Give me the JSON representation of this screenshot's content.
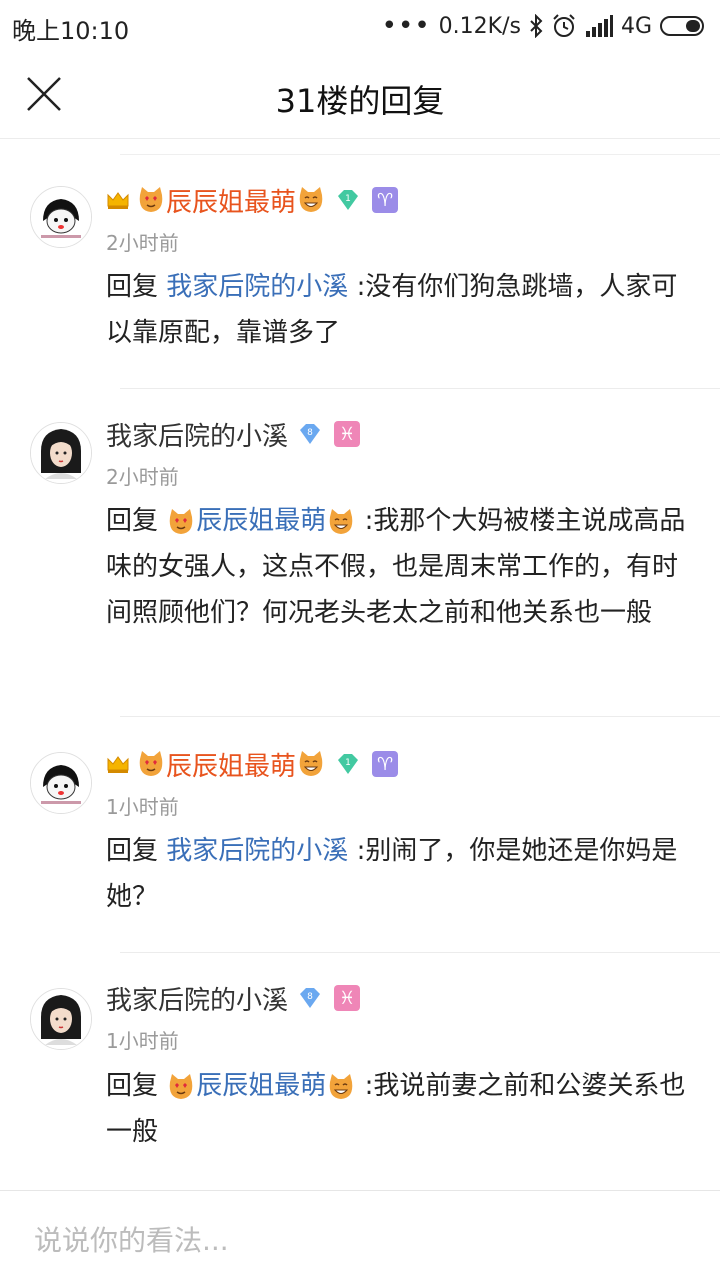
{
  "status_bar": {
    "time": "晚上10:10",
    "speed": "0.12K/s",
    "network": "4G"
  },
  "header": {
    "title": "31楼的回复"
  },
  "posts": [
    {
      "user": "辰辰姐最萌",
      "time": "2小时前",
      "reply_prefix": "回复",
      "reply_to": "我家后院的小溪",
      "text": ":没有你们狗急跳墙，人家可以靠原配，靠谱多了",
      "level": "1"
    },
    {
      "user": "我家后院的小溪",
      "time": "2小时前",
      "reply_prefix": "回复",
      "reply_to": "辰辰姐最萌",
      "text": ":我那个大妈被楼主说成高品味的女强人，这点不假，也是周末常工作的，有时间照顾他们？何况老头老太之前和他关系也一般",
      "level": "8"
    },
    {
      "user": "辰辰姐最萌",
      "time": "1小时前",
      "reply_prefix": "回复",
      "reply_to": "我家后院的小溪",
      "text": ":别闹了，你是她还是你妈是她？",
      "level": "1"
    },
    {
      "user": "我家后院的小溪",
      "time": "1小时前",
      "reply_prefix": "回复",
      "reply_to": "辰辰姐最萌",
      "text": ":我说前妻之前和公婆关系也一般",
      "level": "8"
    }
  ],
  "input": {
    "placeholder": "说说你的看法..."
  },
  "colors": {
    "username_vip": "#e8541e",
    "link": "#3a6fb8",
    "time": "#9a9a9a"
  }
}
